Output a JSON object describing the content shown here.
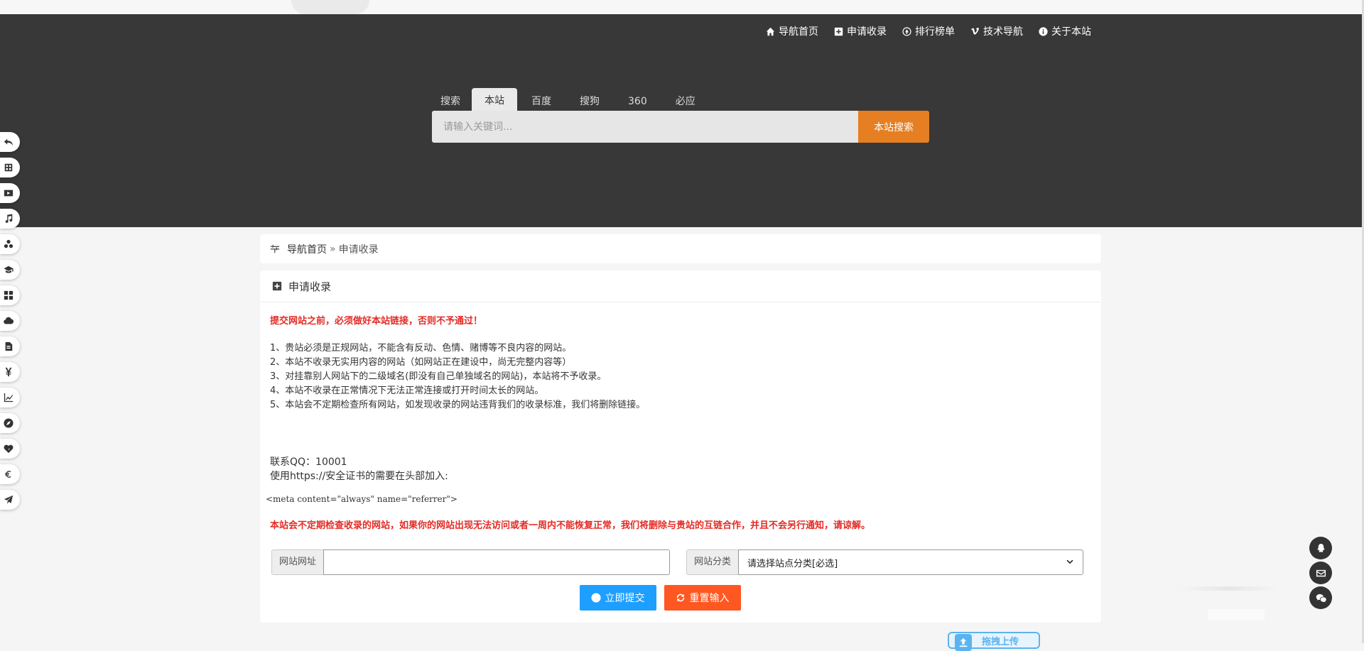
{
  "topnav": [
    {
      "label": "导航首页",
      "icon": "home-icon"
    },
    {
      "label": "申请收录",
      "icon": "plus-square-icon"
    },
    {
      "label": "排行榜单",
      "icon": "ranking-icon"
    },
    {
      "label": "技术导航",
      "icon": "vimeo-icon"
    },
    {
      "label": "关于本站",
      "icon": "info-icon"
    }
  ],
  "search": {
    "tabs": [
      "搜索",
      "本站",
      "百度",
      "搜狗",
      "360",
      "必应"
    ],
    "active_tab": "本站",
    "placeholder": "请输入关键词...",
    "button": "本站搜索"
  },
  "sidebar_icons": [
    "back-icon",
    "grid-app-icon",
    "video-icon",
    "music-icon",
    "share-icon",
    "graduation-icon",
    "apps-icon",
    "cloud-icon",
    "document-icon",
    "yen-icon",
    "chart-icon",
    "compass-icon",
    "heartbeat-icon",
    "euro-icon",
    "send-icon"
  ],
  "breadcrumb": {
    "home": "导航首页",
    "sep": "»",
    "current": "申请收录"
  },
  "panel": {
    "title": "申请收录",
    "warning_top": "提交网站之前，必须做好本站链接，否则不予通过！",
    "rules": [
      "1、贵站必须是正规网站，不能含有反动、色情、赌博等不良内容的网站。",
      "2、本站不收录无实用内容的网站（如网站正在建设中，尚无完整内容等）",
      "3、对挂靠别人网站下的二级域名(即没有自己单独域名的网站)，本站将不予收录。",
      "4、本站不收录在正常情况下无法正常连接或打开时间太长的网站。",
      "5、本站会不定期检查所有网站，如发现收录的网站违背我们的收录标准，我们将删除链接。"
    ],
    "contact_qq": "联系QQ：10001",
    "https_note": "使用https://安全证书的需要在头部加入:",
    "meta_code": "<meta content=\"always\" name=\"referrer\">",
    "warning_bottom": "本站会不定期检查收录的网站，如果你的网站出现无法访问或者一周内不能恢复正常，我们将删除与贵站的互链合作，并且不会另行通知，请谅解。",
    "form": {
      "url_label": "网站网址",
      "url_value": "",
      "category_label": "网站分类",
      "category_selected": "请选择站点分类[必选]"
    },
    "submit_button": "立即提交",
    "reset_button": "重置输入"
  },
  "right_float_icons": [
    "qq-icon",
    "mail-icon",
    "wechat-icon"
  ],
  "upload_button": "拖拽上传",
  "colors": {
    "header_bg": "#383838",
    "accent": "#e67e22",
    "warning_red": "#e32b25",
    "submit_blue": "#1e9fff",
    "reset_orange": "#ff5722"
  }
}
